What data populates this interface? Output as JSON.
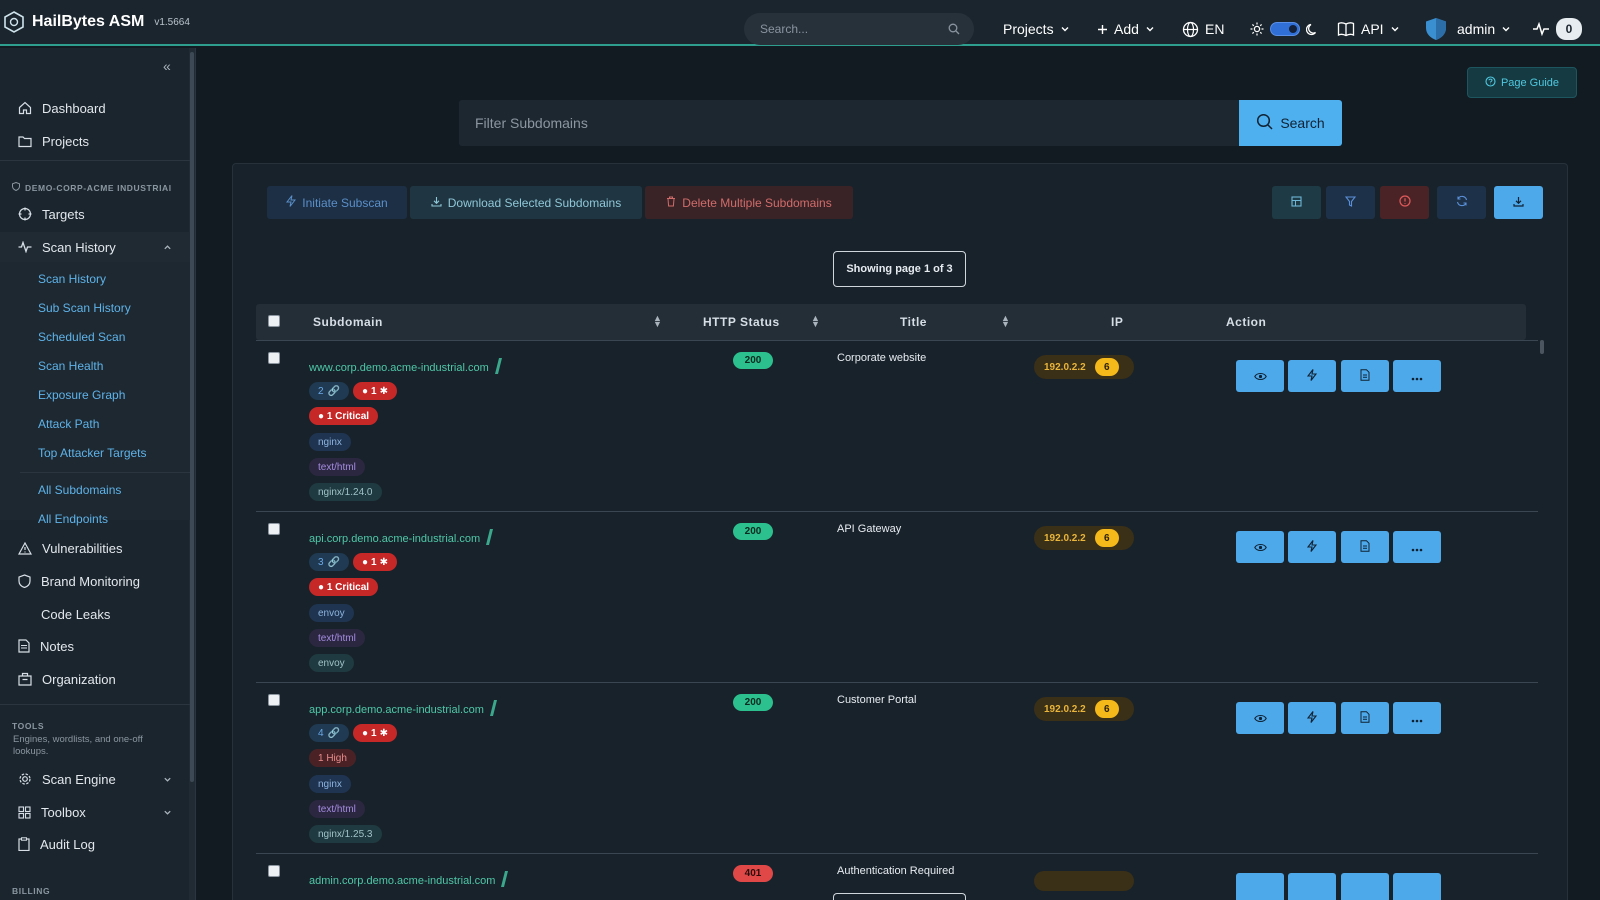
{
  "brand": {
    "name": "HailBytes ASM",
    "version": "v1.5664"
  },
  "topbar": {
    "search_placeholder": "Search...",
    "projects": "Projects",
    "add": "Add",
    "language": "EN",
    "api": "API",
    "user": "admin",
    "activity_count": "0"
  },
  "sidebar": {
    "collapse": "«",
    "dashboard": "Dashboard",
    "projects": "Projects",
    "project_section": "DEMO-CORP-ACME INDUSTRIAl",
    "targets": "Targets",
    "scan_history": "Scan History",
    "scan_sub": [
      "Scan History",
      "Sub Scan History",
      "Scheduled Scan",
      "Scan Health",
      "Exposure Graph",
      "Attack Path",
      "Top Attacker Targets"
    ],
    "recon_sub": [
      "All Subdomains",
      "All Endpoints"
    ],
    "vulnerabilities": "Vulnerabilities",
    "brand_monitoring": "Brand Monitoring",
    "code_leaks": "Code Leaks",
    "notes": "Notes",
    "organization": "Organization",
    "tools_section": "TOOLS",
    "tools_desc": "Engines, wordlists, and one-off lookups.",
    "scan_engine": "Scan Engine",
    "toolbox": "Toolbox",
    "audit_log": "Audit Log",
    "billing_section": "BILLING"
  },
  "main": {
    "page_guide": "Page Guide",
    "filter_placeholder": "Filter Subdomains",
    "search_button": "Search",
    "initiate_subscan": "Initiate Subscan",
    "download_selected": "Download Selected Subdomains",
    "delete_multiple": "Delete Multiple Subdomains",
    "showing": "Showing page 1 of 3",
    "columns": {
      "subdomain": "Subdomain",
      "http_status": "HTTP Status",
      "title": "Title",
      "ip": "IP",
      "action": "Action"
    },
    "rows": [
      {
        "subdomain": "www.corp.demo.acme-industrial.com",
        "endpoints": "2",
        "vulns": "1",
        "severity": "1 Critical",
        "severity_level": "critical",
        "tech": "nginx",
        "content_type": "text/html",
        "server": "nginx/1.24.0",
        "status": "200",
        "title": "Corporate website",
        "ip": "192.0.2.2",
        "ip_count": "6"
      },
      {
        "subdomain": "api.corp.demo.acme-industrial.com",
        "endpoints": "3",
        "vulns": "1",
        "severity": "1 Critical",
        "severity_level": "critical",
        "tech": "envoy",
        "content_type": "text/html",
        "server": "envoy",
        "status": "200",
        "title": "API Gateway",
        "ip": "192.0.2.2",
        "ip_count": "6"
      },
      {
        "subdomain": "app.corp.demo.acme-industrial.com",
        "endpoints": "4",
        "vulns": "1",
        "severity": "1 High",
        "severity_level": "high",
        "tech": "nginx",
        "content_type": "text/html",
        "server": "nginx/1.25.3",
        "status": "200",
        "title": "Customer Portal",
        "ip": "192.0.2.2",
        "ip_count": "6"
      },
      {
        "subdomain": "admin.corp.demo.acme-industrial.com",
        "status": "401",
        "title": "Authentication Required"
      }
    ]
  },
  "colors": {
    "accent": "#4fb0f0",
    "link": "#4fc7a8",
    "critical": "#c62828",
    "ok": "#2bc08e",
    "error": "#e04848",
    "ip_badge": "#f5b91a"
  }
}
